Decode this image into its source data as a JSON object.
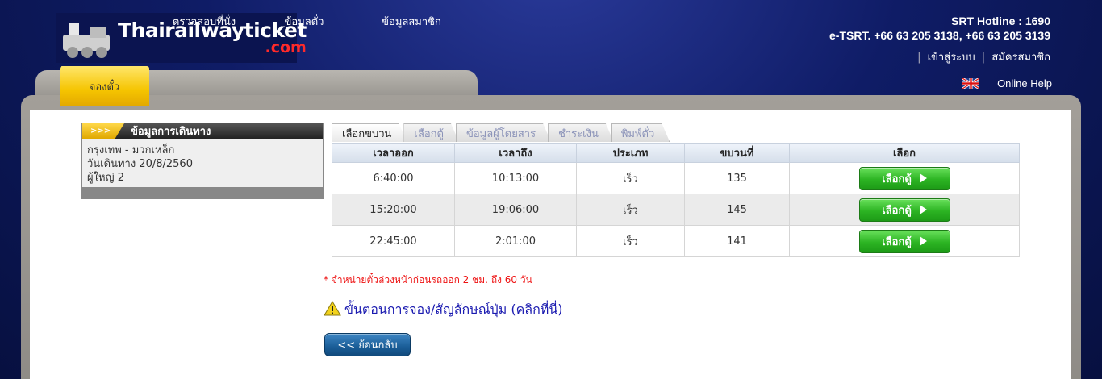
{
  "header": {
    "logo_main": "Thairailwayticket",
    "logo_com": ".com",
    "hotline": "SRT Hotline : 1690",
    "etsrt": "e-TSRT. +66 63 205 3138, +66 63 205 3139",
    "login": "เข้าสู่ระบบ",
    "register": "สมัครสมาชิก",
    "online_help": "Online Help"
  },
  "nav": {
    "items": [
      {
        "label": "จองตั๋ว"
      },
      {
        "label": "ตรวจสอบที่นั่ง"
      },
      {
        "label": "ข้อมูลตั๋ว"
      },
      {
        "label": "ข้อมูลสมาชิก"
      }
    ]
  },
  "trip": {
    "title": "ข้อมูลการเดินทาง",
    "arrow": ">>>",
    "route": "กรุงเทพ - มวกเหล็ก",
    "date": "วันเดินทาง 20/8/2560",
    "passengers": "ผู้ใหญ่ 2"
  },
  "steps": [
    "เลือกขบวน",
    "เลือกตู้",
    "ข้อมูลผู้โดยสาร",
    "ชำระเงิน",
    "พิมพ์ตั๋ว"
  ],
  "table": {
    "headers": [
      "เวลาออก",
      "เวลาถึง",
      "ประเภท",
      "ขบวนที่",
      "เลือก"
    ],
    "rows": [
      {
        "depart": "6:40:00",
        "arrive": "10:13:00",
        "type": "เร็ว",
        "train": "135",
        "button": "เลือกตู้"
      },
      {
        "depart": "15:20:00",
        "arrive": "19:06:00",
        "type": "เร็ว",
        "train": "145",
        "button": "เลือกตู้"
      },
      {
        "depart": "22:45:00",
        "arrive": "2:01:00",
        "type": "เร็ว",
        "train": "141",
        "button": "เลือกตู้"
      }
    ]
  },
  "note": "* จำหน่ายตั๋วล่วงหน้าก่อนรถออก 2 ชม. ถึง 60 วัน",
  "help_link": "ขั้นตอนการจอง/สัญลักษณ์ปุ่ม (คลิกที่นี่)",
  "back_button": "<< ย้อนกลับ",
  "colors": {
    "accent_yellow": "#f5c400",
    "select_green": "#2cb423",
    "back_blue": "#1a5d97",
    "note_red": "#ee1111"
  }
}
